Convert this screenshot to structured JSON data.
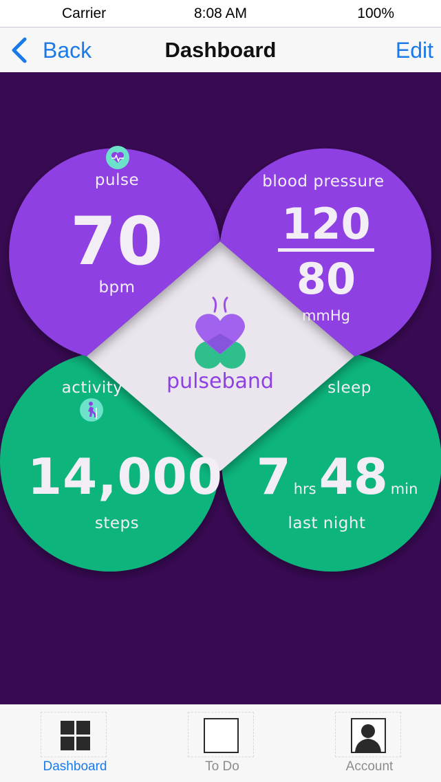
{
  "status_bar": {
    "carrier": "Carrier",
    "time": "8:08 AM",
    "battery": "100%"
  },
  "nav": {
    "back_label": "Back",
    "title": "Dashboard",
    "edit_label": "Edit"
  },
  "pulse": {
    "label": "pulse",
    "value": "70",
    "unit": "bpm",
    "icon": "heart-pulse-icon"
  },
  "blood_pressure": {
    "label": "blood pressure",
    "systolic": "120",
    "diastolic": "80",
    "unit": "mmHg"
  },
  "brand": {
    "name": "pulseband",
    "logo": "butterfly-logo"
  },
  "activity": {
    "label": "activity",
    "value": "14,000",
    "unit": "steps",
    "icon": "walking-person-icon"
  },
  "sleep": {
    "label": "sleep",
    "hours": "7",
    "hours_unit": "hrs",
    "minutes": "48",
    "minutes_unit": "min",
    "caption": "last night"
  },
  "tabs": [
    {
      "label": "Dashboard",
      "icon": "grid-icon",
      "active": true
    },
    {
      "label": "To Do",
      "icon": "square-icon",
      "active": false
    },
    {
      "label": "Account",
      "icon": "person-icon",
      "active": false
    }
  ],
  "colors": {
    "background": "#390a54",
    "purple": "#8e41e3",
    "green": "#10b57d",
    "diamond": "#ebe6ee",
    "accent_blue": "#1a7ae8",
    "brand_purple": "#8e41e3"
  }
}
